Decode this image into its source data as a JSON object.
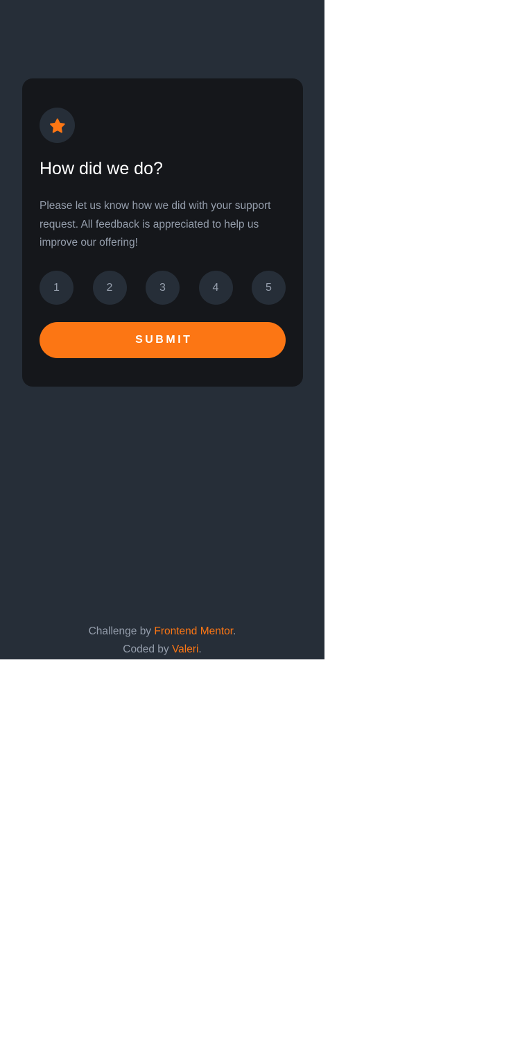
{
  "colors": {
    "page_background": "#262e38",
    "card_background": "#15171b",
    "accent": "#fc7614",
    "muted_text": "#959eac",
    "heading_text": "#ffffff",
    "rating_background": "#262e38"
  },
  "card": {
    "icon": "star-icon",
    "title": "How did we do?",
    "description": "Please let us know how we did with your support request. All feedback is appreciated to help us improve our offering!",
    "ratings": [
      "1",
      "2",
      "3",
      "4",
      "5"
    ],
    "submit_label": "SUBMIT"
  },
  "footer": {
    "challenge_prefix": "Challenge by ",
    "challenge_link": "Frontend Mentor",
    "challenge_suffix": ".",
    "coded_prefix": "Coded by ",
    "coded_link": "Valeri",
    "coded_suffix": "."
  }
}
